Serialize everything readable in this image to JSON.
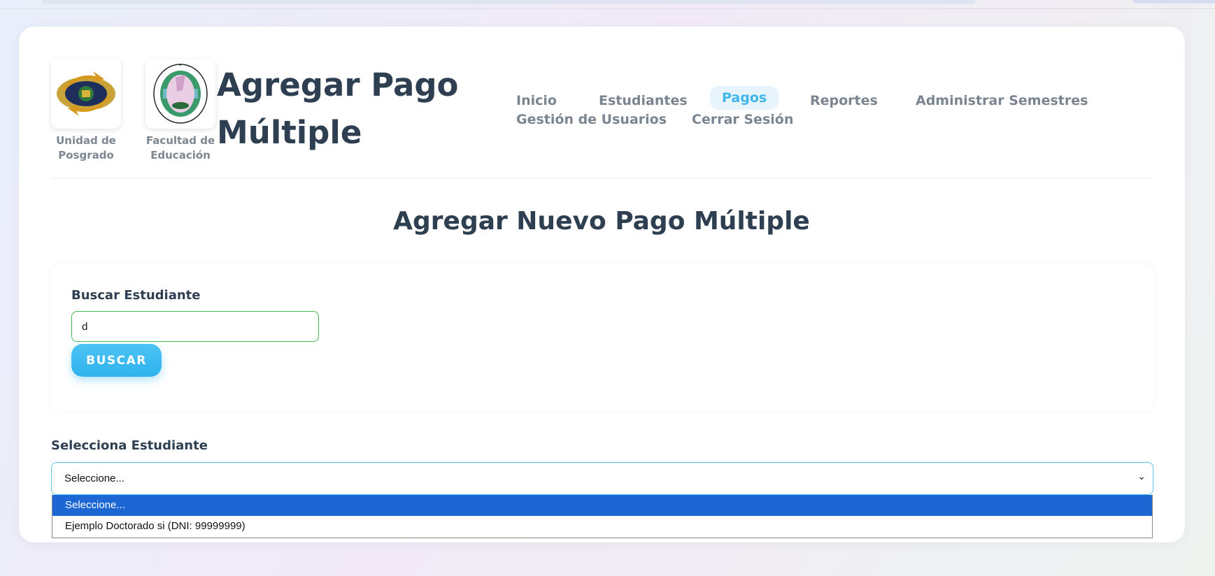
{
  "header": {
    "logos": [
      {
        "caption_line1": "Unidad de",
        "caption_line2": "Posgrado",
        "icon": "posgrado-seal-icon"
      },
      {
        "caption_line1": "Facultad de",
        "caption_line2": "Educación",
        "icon": "facultad-seal-icon"
      }
    ],
    "title_line1": "Agregar Pago",
    "title_line2": "Múltiple"
  },
  "nav": {
    "items": [
      {
        "label": "Inicio"
      },
      {
        "label": "Estudiantes"
      },
      {
        "label": "Pagos",
        "active": true
      },
      {
        "label": "Reportes"
      },
      {
        "label": "Administrar Semestres"
      },
      {
        "label": "Gestión de Usuarios"
      },
      {
        "label": "Cerrar Sesión"
      }
    ]
  },
  "main": {
    "section_title": "Agregar Nuevo Pago Múltiple",
    "search": {
      "label": "Buscar Estudiante",
      "value": "d",
      "button_label": "BUSCAR"
    },
    "student_select": {
      "label": "Selecciona Estudiante",
      "selected": "Seleccione...",
      "options": [
        "Seleccione...",
        "Ejemplo Doctorado si (DNI: 99999999)"
      ]
    }
  },
  "colors": {
    "accent": "#3fb6ea",
    "title": "#2f3f52",
    "input_border": "#3fb950",
    "option_highlight": "#1c67d3"
  }
}
